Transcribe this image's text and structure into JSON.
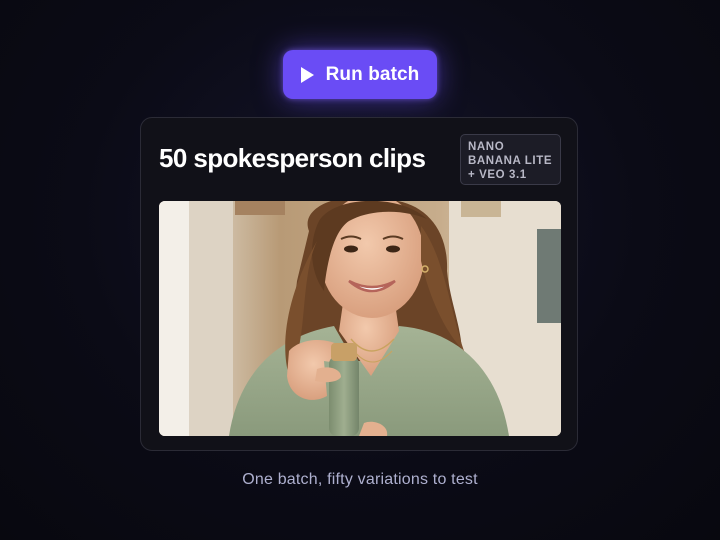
{
  "run_button": {
    "label": "Run batch",
    "icon": "play-icon",
    "color": "#6a4cf5"
  },
  "card": {
    "title": "50 spokesperson clips",
    "badge": {
      "line1": "NANO",
      "line2": "BANANA LITE",
      "line3": "+ VEO 3.1"
    },
    "image": {
      "subject": "smiling woman with long wavy brown hair in a sage green knit cardigan holding a sage green bottle with bamboo cap"
    }
  },
  "caption": "One batch, fifty variations to test"
}
